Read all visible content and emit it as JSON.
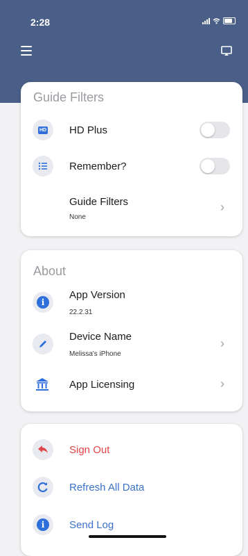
{
  "status": {
    "time": "2:28"
  },
  "guide_filters": {
    "title": "Guide Filters",
    "hd_plus": {
      "label": "HD Plus",
      "icon_text": "HD",
      "enabled": false
    },
    "remember": {
      "label": "Remember?",
      "enabled": false
    },
    "filters": {
      "label": "Guide Filters",
      "value": "None"
    }
  },
  "about": {
    "title": "About",
    "app_version": {
      "label": "App Version",
      "value": "22.2.31"
    },
    "device_name": {
      "label": "Device Name",
      "value": "Melissa's iPhone"
    },
    "app_licensing": {
      "label": "App Licensing"
    }
  },
  "actions": {
    "sign_out": "Sign Out",
    "refresh": "Refresh All Data",
    "send_log": "Send Log"
  },
  "colors": {
    "header": "#4a5f88",
    "accent_blue": "#2f6fdc",
    "danger_red": "#e0454a",
    "link_blue": "#3a72c8"
  }
}
